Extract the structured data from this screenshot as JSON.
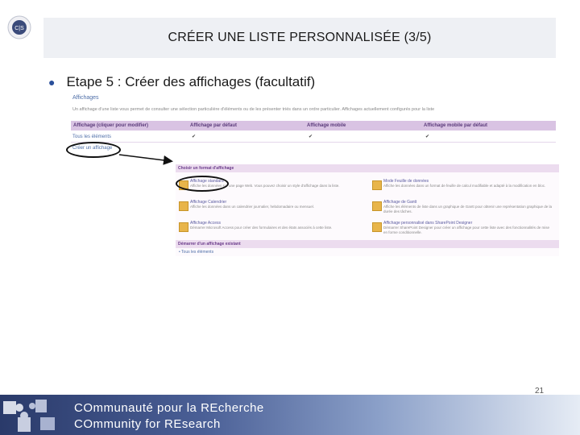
{
  "slide": {
    "logo_text": "C|S",
    "title": "CRÉER UNE LISTE PERSONNALISÉE (3/5)",
    "bullet": "Etape 5 : Créer des affichages (facultatif)",
    "page_number": "21"
  },
  "screenshot": {
    "section_title": "Affichages",
    "section_desc": "Un affichage d'une liste vous permet de consulter une sélection particulière d'éléments ou de les présenter triés dans un ordre particulier. Affichages actuellement configurés pour la liste",
    "headers": [
      "Affichage (cliquer pour modifier)",
      "Affichage par défaut",
      "Affichage mobile",
      "Affichage mobile par défaut"
    ],
    "rows": [
      {
        "name": "Tous les éléments",
        "c1": "✔",
        "c2": "✔",
        "c3": "✔"
      },
      {
        "name": "Créer un affichage",
        "c1": "",
        "c2": "",
        "c3": ""
      }
    ],
    "popup": {
      "head1": "Choisir un format d'affichage",
      "head2": "Démarrer d'un affichage existant",
      "options_left": [
        {
          "title": "Affichage standard",
          "desc": "Affiche les données sur une page Web. Vous pouvez choisir un style d'affichage dans la liste."
        },
        {
          "title": "Affichage Calendrier",
          "desc": "Affiche les données dans un calendrier journalier, hebdomadaire ou mensuel."
        },
        {
          "title": "Affichage Access",
          "desc": "Démarrer Microsoft Access pour créer des formulaires et des états associés à cette liste."
        }
      ],
      "options_right": [
        {
          "title": "Mode Feuille de données",
          "desc": "Affiche les données dans un format de feuille de calcul modifiable et adapté à la modification en bloc."
        },
        {
          "title": "Affichage de Gantt",
          "desc": "Affiche les éléments de liste dans un graphique de Gantt pour obtenir une représentation graphique de la durée des tâches."
        },
        {
          "title": "Affichage personnalisé dans SharePoint Designer",
          "desc": "Démarrer SharePoint Designer pour créer un affichage pour cette liste avec des fonctionnalités de mise en forme conditionnelle."
        }
      ],
      "link": "• Tous les éléments"
    }
  },
  "footer": {
    "line1": "COmmunauté pour la REcherche",
    "line2": "COmmunity for REsearch"
  }
}
